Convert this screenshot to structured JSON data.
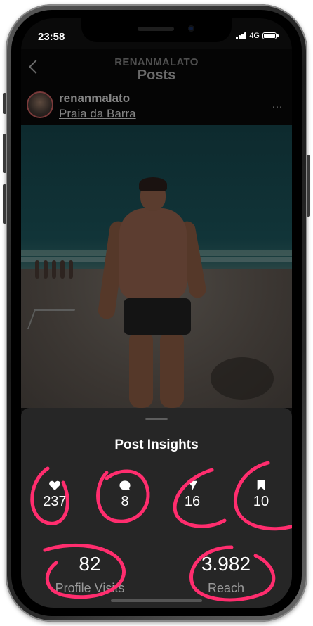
{
  "status_bar": {
    "time": "23:58",
    "network": "4G"
  },
  "header": {
    "username": "RENANMALATO",
    "title": "Posts"
  },
  "post": {
    "username": "renanmalato",
    "location": "Praia da Barra",
    "more_glyph": "…"
  },
  "insights": {
    "title": "Post Insights",
    "metrics": [
      {
        "icon": "heart-icon",
        "value": "237"
      },
      {
        "icon": "comment-icon",
        "value": "8"
      },
      {
        "icon": "share-icon",
        "value": "16"
      },
      {
        "icon": "bookmark-icon",
        "value": "10"
      }
    ],
    "profile_visits": {
      "value": "82",
      "label": "Profile Visits"
    },
    "reach": {
      "value": "3.982",
      "label": "Reach"
    }
  },
  "colors": {
    "scribble": "#ff2d6e",
    "panel": "#262626",
    "text": "#ffffff",
    "muted": "#9a9a9a"
  }
}
